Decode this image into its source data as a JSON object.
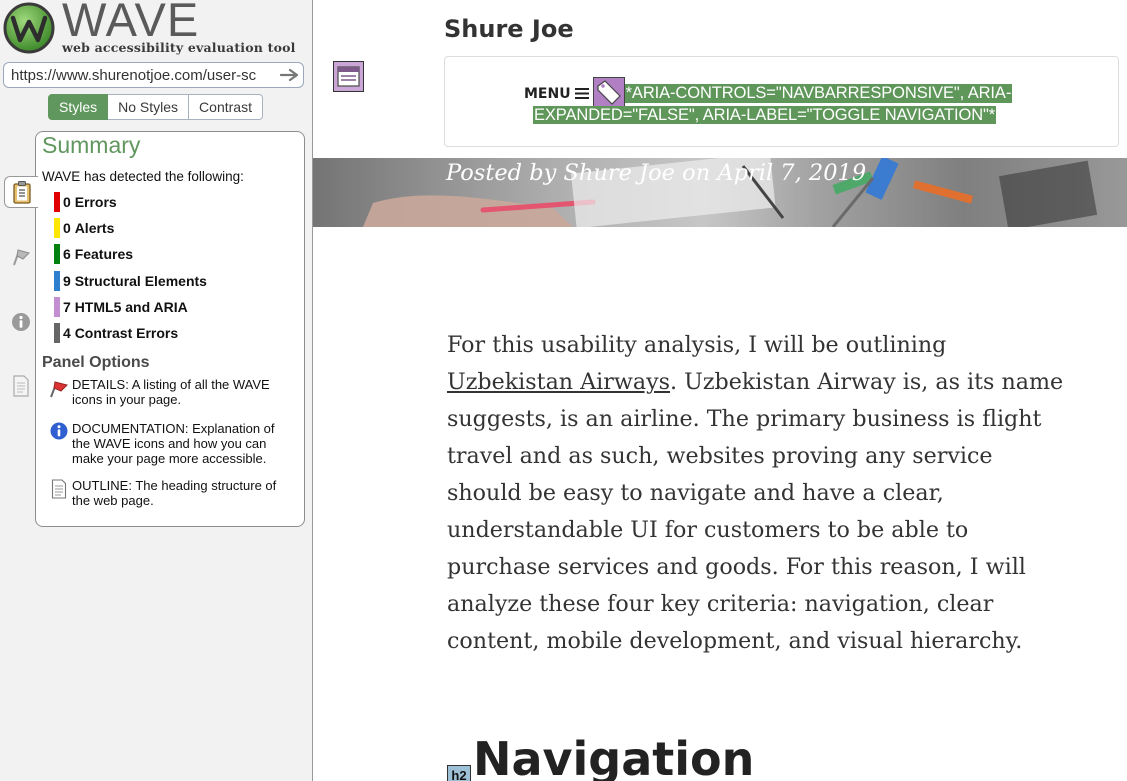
{
  "wave": {
    "wordmark": "WAVE",
    "tagline": "web accessibility evaluation tool",
    "url": "https://www.shurenotjoe.com/user-sc",
    "style_tabs": [
      {
        "label": "Styles",
        "active": true
      },
      {
        "label": "No Styles",
        "active": false
      },
      {
        "label": "Contrast",
        "active": false
      }
    ],
    "summary": {
      "title": "Summary",
      "intro": "WAVE has detected the following:",
      "items": [
        {
          "count": "0",
          "label": "Errors",
          "color": "#e00000"
        },
        {
          "count": "0",
          "label": "Alerts",
          "color": "#ffe600"
        },
        {
          "count": "6",
          "label": "Features",
          "color": "#00800e"
        },
        {
          "count": "9",
          "label": "Structural Elements",
          "color": "#2f7fd1"
        },
        {
          "count": "7",
          "label": "HTML5 and ARIA",
          "color": "#c48fd0"
        },
        {
          "count": "4",
          "label": "Contrast Errors",
          "color": "#666666"
        }
      ]
    },
    "panel_options": {
      "title": "Panel Options",
      "details": "DETAILS: A listing of all the WAVE icons in your page.",
      "documentation": "DOCUMENTATION: Explanation of the WAVE icons and how you can make your page more accessible.",
      "outline": "OUTLINE: The heading structure of the web page."
    },
    "side_icons": [
      "clipboard-icon",
      "flag-icon",
      "info-icon",
      "document-icon"
    ]
  },
  "page": {
    "site_title": "Shure Joe",
    "menu": {
      "label": "MENU",
      "aria_line1": "*ARIA-CONTROLS=\"NAVBARRESPONSIVE\", ARIA-",
      "aria_line2": "EXPANDED=\"FALSE\", ARIA-LABEL=\"TOGGLE NAVIGATION\"*"
    },
    "byline": "Posted by Shure Joe on April 7, 2019",
    "article": {
      "line1": "For this usability analysis, I will be outlining",
      "link": "Uzbekistan Airways",
      "line2_rest": ". Uzbekistan Airway is, as its name",
      "line3": "suggests, is an airline. The primary business is flight",
      "line4": "travel and as such, websites proving any service",
      "line5": "should be easy to navigate and have a clear,",
      "line6": "understandable UI for customers to be able to",
      "line7": "purchase services and goods. For this reason, I will",
      "line8": "analyze these four key criteria: navigation, clear",
      "line9": "content, mobile development, and visual hierarchy."
    },
    "h2_badge": "h2",
    "h2_heading": "Navigation"
  }
}
